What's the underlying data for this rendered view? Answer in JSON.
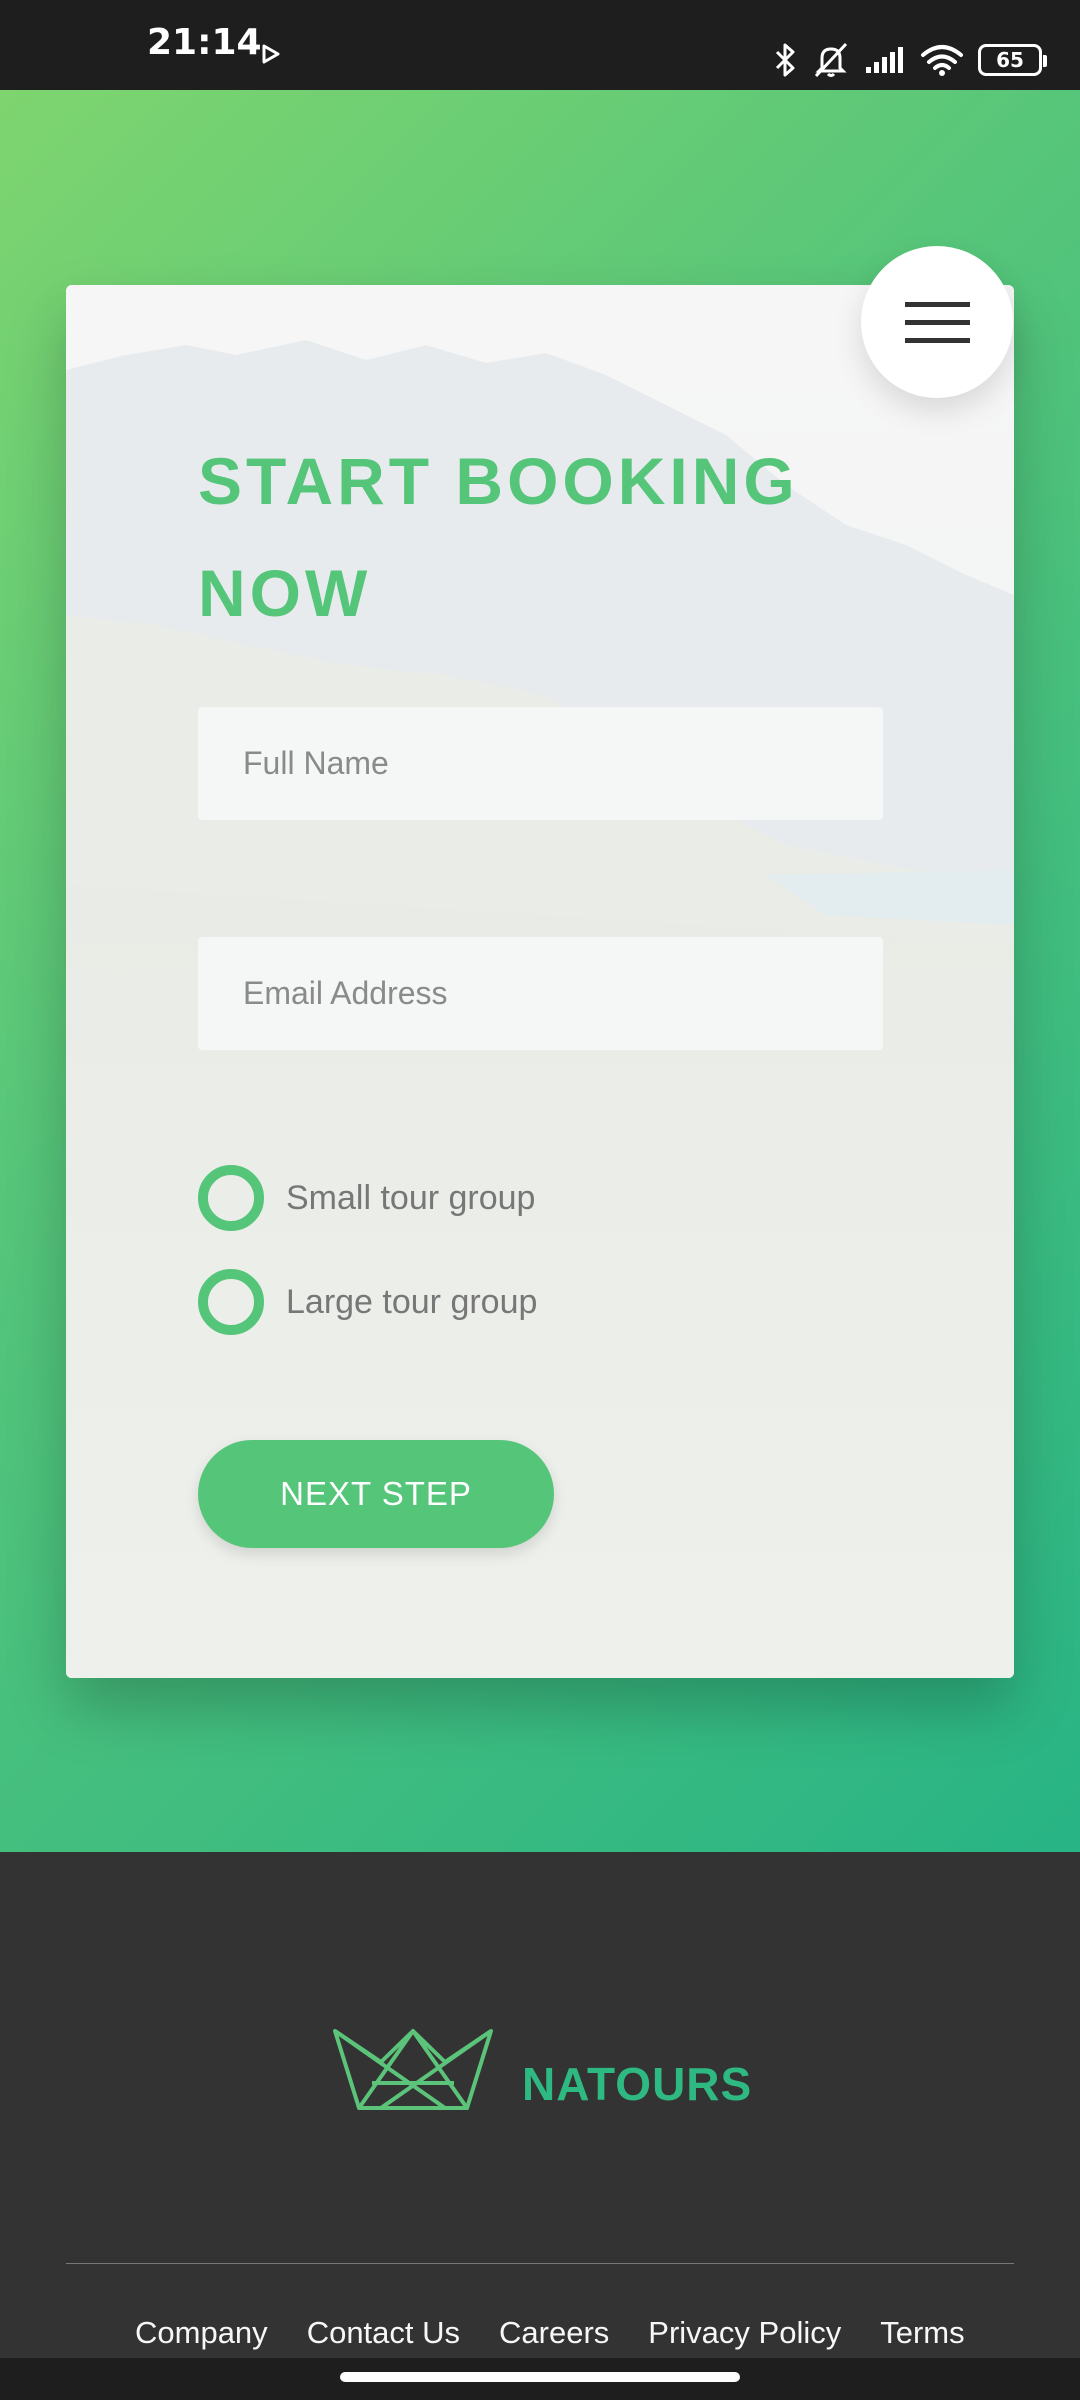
{
  "status_bar": {
    "time": "21:14",
    "battery": "65",
    "icons": [
      "play-icon",
      "bluetooth-icon",
      "mute-icon",
      "signal-icon",
      "wifi-icon",
      "battery-icon"
    ]
  },
  "colors": {
    "gradient_start": "#7ed56f",
    "gradient_mid": "#55c57a",
    "gradient_end": "#28b485",
    "accent": "#55c57a",
    "footer_bg": "#333333",
    "brand": "#2fb982"
  },
  "booking": {
    "title": "START BOOKING NOW",
    "full_name_placeholder": "Full Name",
    "email_placeholder": "Email Address",
    "options": [
      {
        "label": "Small tour group"
      },
      {
        "label": "Large tour group"
      }
    ],
    "next_label": "NEXT STEP"
  },
  "menu": {
    "icon": "hamburger-menu-icon"
  },
  "footer": {
    "brand": "NATOURS",
    "logo_icon": "crown-logo-icon",
    "links": [
      "Company",
      "Contact Us",
      "Careers",
      "Privacy Policy",
      "Terms"
    ]
  }
}
